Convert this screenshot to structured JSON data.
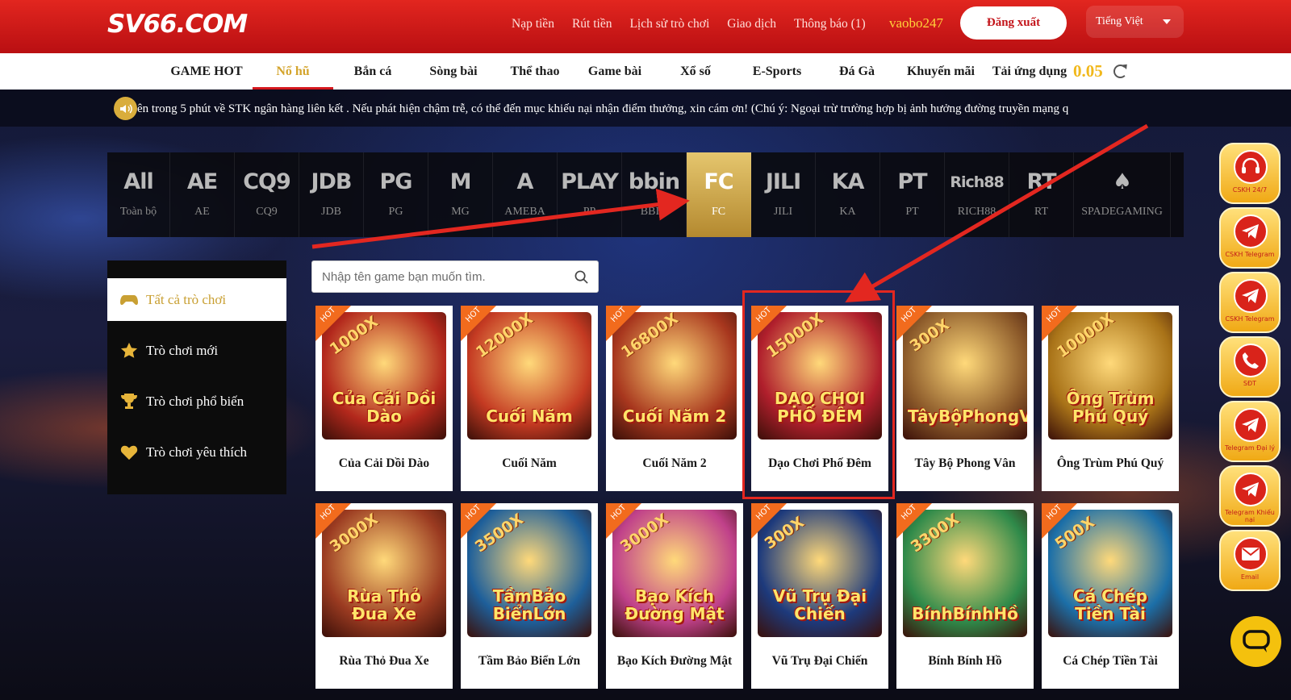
{
  "header": {
    "logo": "SV66.COM",
    "nav": [
      "Nạp tiền",
      "Rút tiền",
      "Lịch sử trò chơi",
      "Giao dịch",
      "Thông báo (1)"
    ],
    "username": "vaobo247",
    "logout_label": "Đăng xuất",
    "language": "Tiếng Việt"
  },
  "main_nav": {
    "items": [
      "GAME HOT",
      "Nổ hũ",
      "Bắn cá",
      "Sòng bài",
      "Thể thao",
      "Game bài",
      "Xổ số",
      "E-Sports",
      "Đá Gà",
      "Khuyến mãi",
      "Tải ứng dụng"
    ],
    "active": "Nổ hũ",
    "balance": "0.05"
  },
  "marquee": {
    "text": "ên trong 5 phút về STK ngân hàng liên kết . Nếu phát hiện chậm trễ, có thể đến mục khiếu nại nhận điểm thưởng, xin cám ơn! (Chú ý: Ngoại trừ trường hợp bị ảnh hưởng đường truyền mạng q"
  },
  "providers": [
    {
      "logo": "All",
      "label": "Toàn bộ"
    },
    {
      "logo": "AE",
      "label": "AE",
      "icon": "slot-machine-icon"
    },
    {
      "logo": "CQ9",
      "label": "CQ9"
    },
    {
      "logo": "JDB",
      "label": "JDB"
    },
    {
      "logo": "PG",
      "label": "PG"
    },
    {
      "logo": "M",
      "label": "MG"
    },
    {
      "logo": "A",
      "label": "AMEBA"
    },
    {
      "logo": "PLAY",
      "label": "PP"
    },
    {
      "logo": "bbin",
      "label": "BBIN"
    },
    {
      "logo": "FC",
      "label": "FC",
      "active": true
    },
    {
      "logo": "JILI",
      "label": "JILI"
    },
    {
      "logo": "KA",
      "label": "KA"
    },
    {
      "logo": "PT",
      "label": "PT"
    },
    {
      "logo": "Rich88",
      "label": "RICH88"
    },
    {
      "logo": "RT",
      "label": "RT"
    },
    {
      "logo": "♠",
      "label": "SPADEGAMING"
    }
  ],
  "left_menu": [
    {
      "label": "Tất cả trò chơi",
      "icon": "gamepad-icon",
      "active": true
    },
    {
      "label": "Trò chơi mới",
      "icon": "star-icon"
    },
    {
      "label": "Trò chơi phổ biến",
      "icon": "trophy-icon"
    },
    {
      "label": "Trò chơi yêu thích",
      "icon": "heart-icon"
    }
  ],
  "search": {
    "placeholder": "Nhập tên game bạn muốn tìm."
  },
  "games": [
    {
      "name": "Của Cải Dồi Dào",
      "badge": "HOT",
      "multiplier": "1000X",
      "art_title": "Của Cải Dồi Dào",
      "color": "#b3281c"
    },
    {
      "name": "Cuối Năm",
      "badge": "HOT",
      "multiplier": "12000X",
      "art_title": "Cuối Năm",
      "color": "#c43a22"
    },
    {
      "name": "Cuối Năm 2",
      "badge": "HOT",
      "multiplier": "16800X",
      "art_title": "Cuối Năm 2",
      "color": "#a8371e"
    },
    {
      "name": "Dạo Chơi Phố Đêm",
      "badge": "HOT",
      "multiplier": "15000X",
      "art_title": "DẠO CHƠI PHỐ ĐÊM",
      "color": "#b01f2c"
    },
    {
      "name": "Tây Bộ Phong Vân",
      "badge": "HOT",
      "multiplier": "300X",
      "art_title": "TâyBộPhongVân",
      "color": "#8c5a2a"
    },
    {
      "name": "Ông Trùm Phú Quý",
      "badge": "HOT",
      "multiplier": "10000X",
      "art_title": "Ông Trùm Phú Quý",
      "color": "#a97318"
    },
    {
      "name": "Rùa Thỏ Đua Xe",
      "badge": "HOT",
      "multiplier": "3000X",
      "art_title": "Rùa Thỏ Đua Xe",
      "color": "#9b3b21"
    },
    {
      "name": "Tầm Bảo Biển Lớn",
      "badge": "HOT",
      "multiplier": "3500X",
      "art_title": "TầmBảo BiểnLớn",
      "color": "#1e5f9a"
    },
    {
      "name": "Bạo Kích Đường Mật",
      "badge": "HOT",
      "multiplier": "3000X",
      "art_title": "Bạo Kích Đường Mật",
      "color": "#c0418a"
    },
    {
      "name": "Vũ Trụ Đại Chiến",
      "badge": "HOT",
      "multiplier": "300X",
      "art_title": "Vũ Trụ Đại Chiến",
      "color": "#1d3a7c"
    },
    {
      "name": "Bính Bính Hồ",
      "badge": "HOT",
      "multiplier": "3300X",
      "art_title": "BínhBínhHồ",
      "color": "#2f8a4a"
    },
    {
      "name": "Cá Chép Tiền Tài",
      "badge": "HOT",
      "multiplier": "500X",
      "art_title": "Cá Chép Tiền Tài",
      "color": "#1c6fa8"
    }
  ],
  "side_buttons": [
    {
      "label": "CSKH 24/7",
      "icon": "headset-icon"
    },
    {
      "label": "CSKH Telegram",
      "icon": "telegram-icon"
    },
    {
      "label": "CSKH Telegram",
      "icon": "telegram-icon"
    },
    {
      "label": "SĐT",
      "icon": "phone-icon"
    },
    {
      "label": "Telegram Đại lý",
      "icon": "telegram-icon"
    },
    {
      "label": "Telegram Khiếu nại",
      "icon": "telegram-icon"
    },
    {
      "label": "Email",
      "icon": "mail-icon"
    }
  ],
  "colors": {
    "brand_red": "#d5171d",
    "gold": "#d4a42c",
    "hot_badge": "#f26b1d",
    "highlight": "#e32720"
  }
}
